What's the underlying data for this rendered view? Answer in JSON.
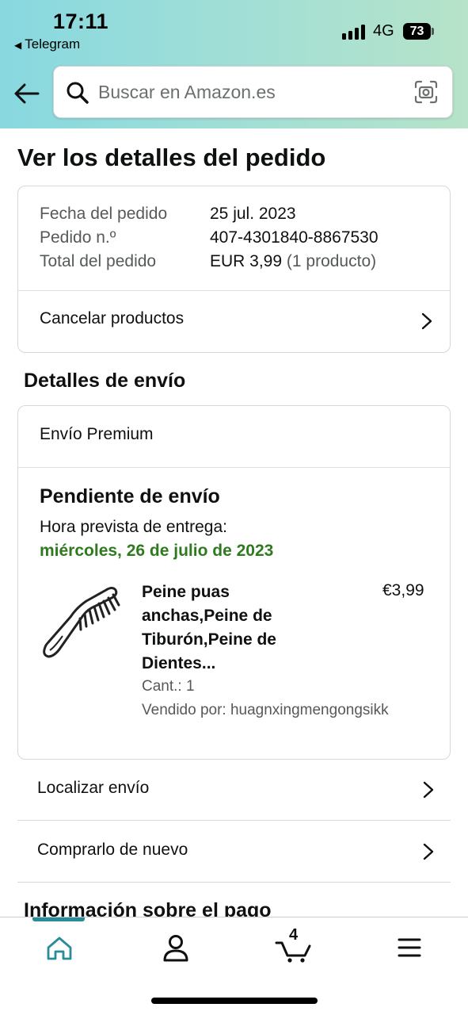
{
  "status_bar": {
    "time": "17:11",
    "back_app": "Telegram",
    "network": "4G",
    "battery": "73"
  },
  "search": {
    "placeholder": "Buscar en Amazon.es"
  },
  "page": {
    "title": "Ver los detalles del pedido"
  },
  "order": {
    "date_label": "Fecha del pedido",
    "date_value": "25 jul. 2023",
    "number_label": "Pedido n.º",
    "number_value": "407-4301840-8867530",
    "total_label": "Total del pedido",
    "total_value": "EUR 3,99",
    "total_note": "(1 producto)",
    "cancel_label": "Cancelar productos"
  },
  "shipping": {
    "section_title": "Detalles de envío",
    "method": "Envío Premium",
    "status": "Pendiente de envío",
    "eta_label": "Hora prevista de entrega:",
    "eta_date": "miércoles, 26 de julio de 2023",
    "eta_color": "#2f7a1f",
    "product": {
      "name": "Peine puas anchas,Peine de Tiburón,Peine de Dientes...",
      "price": "€3,99",
      "quantity": "Cant.: 1",
      "seller": "Vendido por: huagnxingmengongsikk",
      "image_icon": "comb-icon"
    }
  },
  "actions": {
    "track": "Localizar envío",
    "buy_again": "Comprarlo de nuevo"
  },
  "payment": {
    "section_title": "Información sobre el pago"
  },
  "bottom_nav": {
    "items": [
      "home-icon",
      "account-icon",
      "cart-icon",
      "menu-icon"
    ],
    "cart_count": "4",
    "active_color": "#2a8c9a"
  }
}
